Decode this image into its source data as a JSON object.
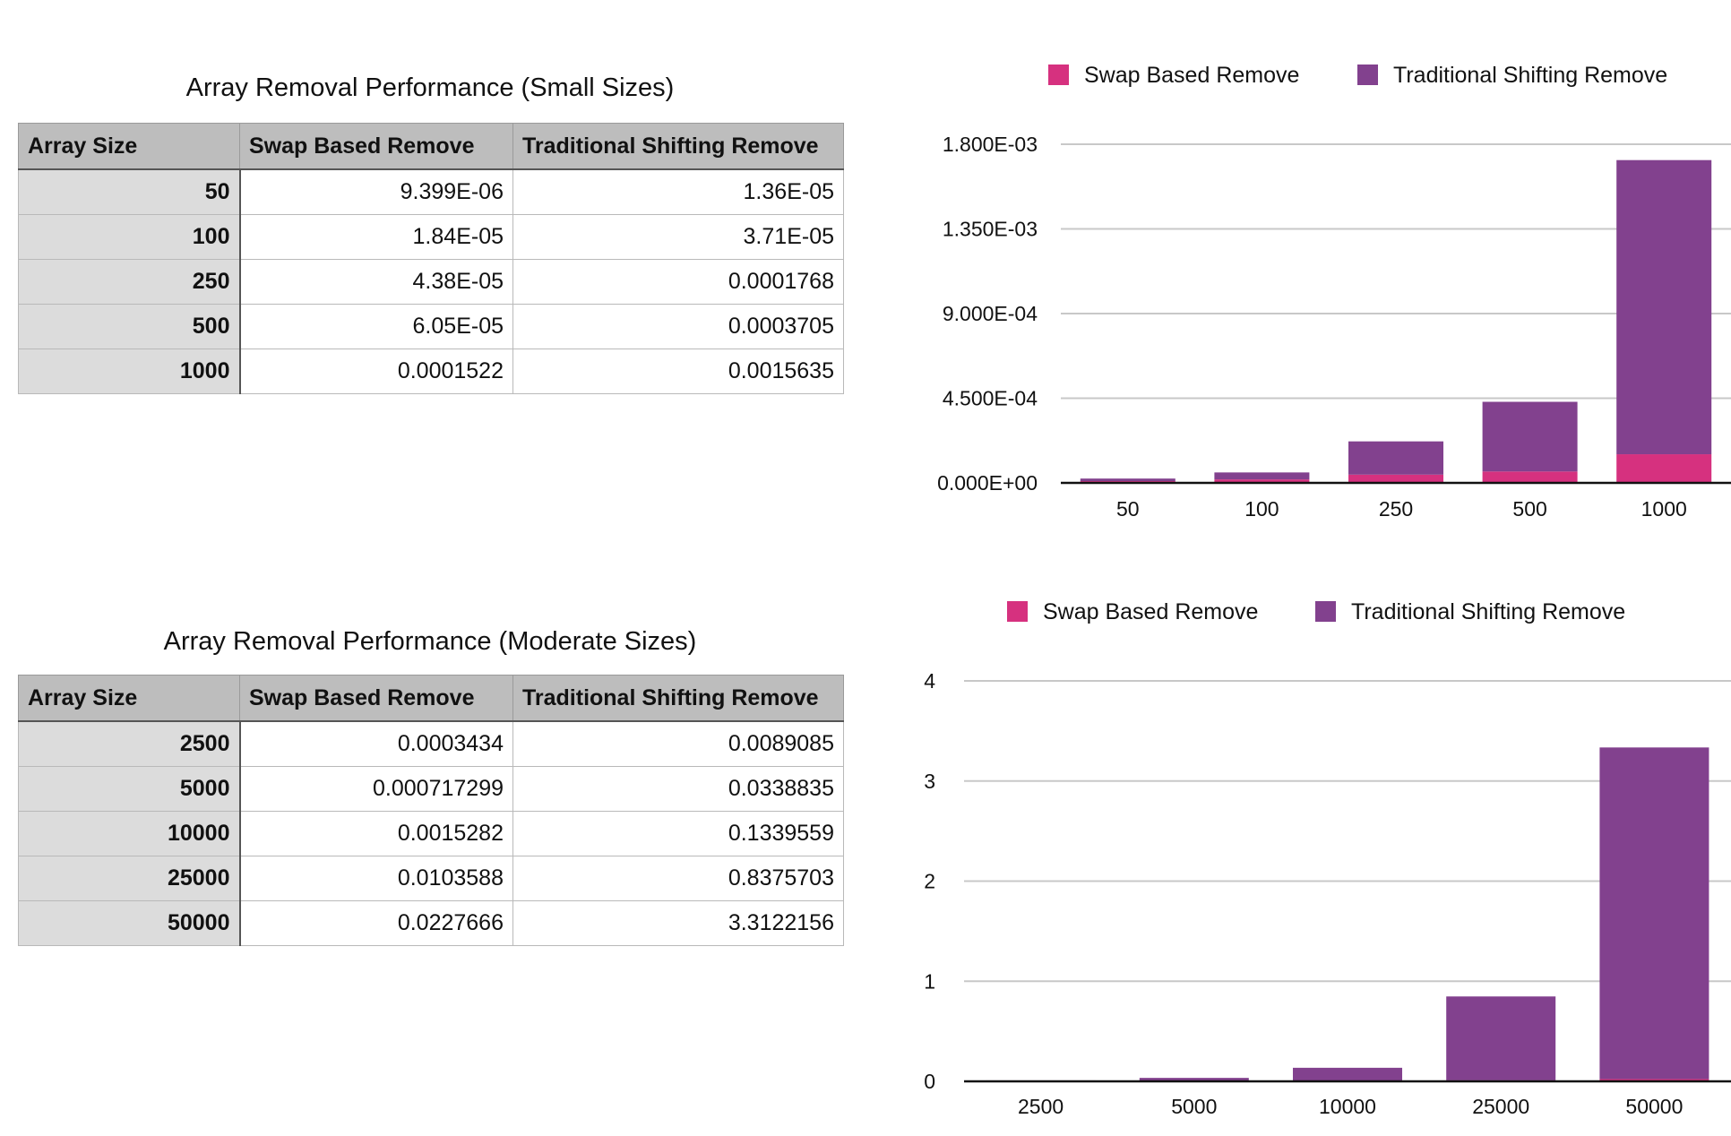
{
  "table_small": {
    "title": "Array Removal Performance (Small Sizes)",
    "headers": [
      "Array Size",
      "Swap Based Remove",
      "Traditional Shifting Remove"
    ],
    "rows": [
      [
        "50",
        "9.399E-06",
        "1.36E-05"
      ],
      [
        "100",
        "1.84E-05",
        "3.71E-05"
      ],
      [
        "250",
        "4.38E-05",
        "0.0001768"
      ],
      [
        "500",
        "6.05E-05",
        "0.0003705"
      ],
      [
        "1000",
        "0.0001522",
        "0.0015635"
      ]
    ]
  },
  "table_moderate": {
    "title": "Array Removal Performance (Moderate Sizes)",
    "headers": [
      "Array Size",
      "Swap Based Remove",
      "Traditional Shifting Remove"
    ],
    "rows": [
      [
        "2500",
        "0.0003434",
        "0.0089085"
      ],
      [
        "5000",
        "0.000717299",
        "0.0338835"
      ],
      [
        "10000",
        "0.0015282",
        "0.1339559"
      ],
      [
        "25000",
        "0.0103588",
        "0.8375703"
      ],
      [
        "50000",
        "0.0227666",
        "3.3122156"
      ]
    ]
  },
  "colors": {
    "swap": "#d6317f",
    "traditional": "#82418e",
    "grid": "#c8c8c8",
    "axis": "#111111"
  },
  "chart_data": [
    {
      "type": "bar",
      "stacked": true,
      "categories": [
        "50",
        "100",
        "250",
        "500",
        "1000"
      ],
      "series": [
        {
          "name": "Swap Based Remove",
          "values": [
            9.399e-06,
            1.84e-05,
            4.38e-05,
            6.05e-05,
            0.0001522
          ]
        },
        {
          "name": "Traditional Shifting Remove",
          "values": [
            1.36e-05,
            3.71e-05,
            0.0001768,
            0.0003705,
            0.0015635
          ]
        }
      ],
      "yticks": [
        "0.000E+00",
        "4.500E-04",
        "9.000E-04",
        "1.350E-03",
        "1.800E-03"
      ],
      "ylim": [
        0,
        0.0018
      ],
      "grid": true,
      "legend": "top"
    },
    {
      "type": "bar",
      "stacked": true,
      "categories": [
        "2500",
        "5000",
        "10000",
        "25000",
        "50000"
      ],
      "series": [
        {
          "name": "Swap Based Remove",
          "values": [
            0.0003434,
            0.000717299,
            0.0015282,
            0.0103588,
            0.0227666
          ]
        },
        {
          "name": "Traditional Shifting Remove",
          "values": [
            0.0089085,
            0.0338835,
            0.1339559,
            0.8375703,
            3.3122156
          ]
        }
      ],
      "yticks": [
        "0",
        "1",
        "2",
        "3",
        "4"
      ],
      "ylim": [
        0,
        4
      ],
      "grid": true,
      "legend": "top"
    }
  ]
}
